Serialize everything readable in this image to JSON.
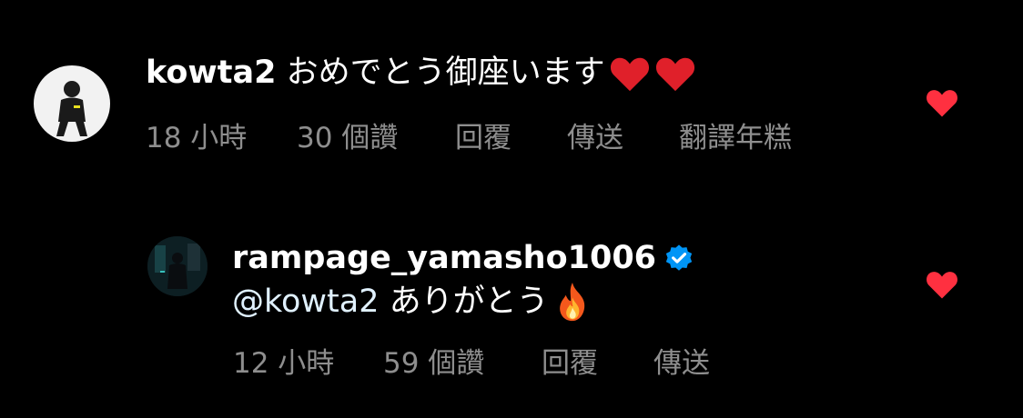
{
  "comments": [
    {
      "username": "kowta2",
      "message": "おめでとう御座います",
      "emojis": [
        "red-heart-emoji",
        "red-heart-emoji"
      ],
      "time": "18 小時",
      "likes": "30 個讚",
      "reply": "回覆",
      "send": "傳送",
      "translate": "翻譯年糕",
      "liked": true
    },
    {
      "username": "rampage_yamasho1006",
      "verified": true,
      "mention": "@kowta2",
      "message": "ありがとう",
      "emojis": [
        "fire-emoji"
      ],
      "time": "12 小時",
      "likes": "59 個讚",
      "reply": "回覆",
      "send": "傳送",
      "liked": true
    }
  ],
  "colors": {
    "background": "#000000",
    "like_heart": "#ff3040",
    "meta_text": "#8e8e8e",
    "verified_badge": "#0095f6",
    "mention": "#e0f1ff"
  }
}
